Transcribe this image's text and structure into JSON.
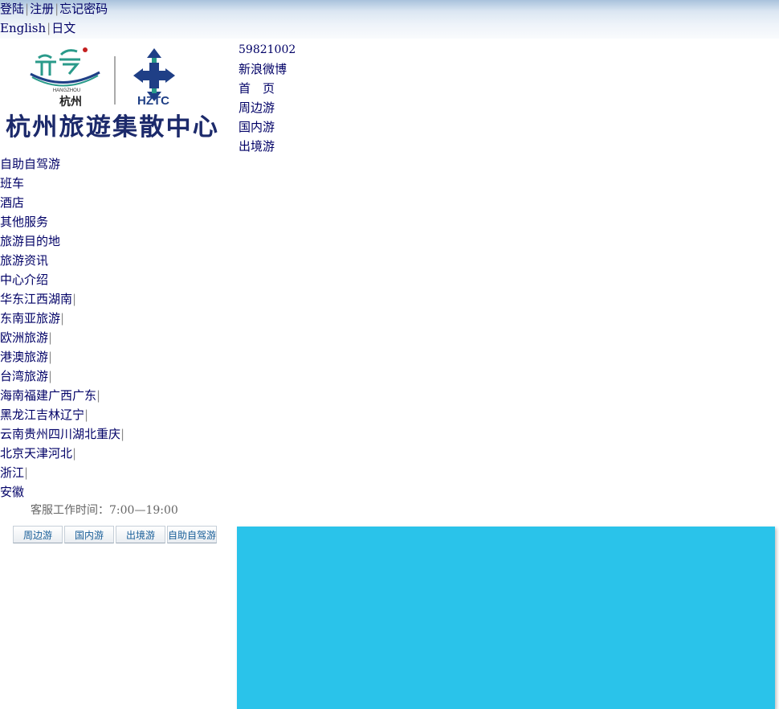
{
  "header": {
    "auth": {
      "login": "登陆",
      "register": "注册",
      "forgot": "忘记密码",
      "sep": "|"
    },
    "lang": {
      "english": "English",
      "japanese": "日文",
      "sep": "|"
    }
  },
  "logo": {
    "city_cn": "杭州",
    "city_en": "HANGZHOU",
    "brand": "HZTC",
    "name": "杭州旅遊集散中心",
    "colors": {
      "teal": "#2a9a8a",
      "navy": "#1f3f86",
      "red": "#c42020",
      "calligraphy": "#1c2a6b"
    }
  },
  "top_links": {
    "phone": "59821002",
    "weibo": "新浪微博",
    "home": "首　页",
    "items": [
      "周边游",
      "国内游",
      "出境游"
    ]
  },
  "main_nav": [
    "自助自驾游",
    "班车",
    "酒店",
    "其他服务",
    "旅游目的地",
    "旅游资讯",
    "中心介绍"
  ],
  "destinations": [
    "华东江西湖南",
    "东南亚旅游",
    "欧洲旅游",
    "港澳旅游",
    "台湾旅游",
    "海南福建广西广东",
    "黑龙江吉林辽宁",
    "云南贵州四川湖北重庆",
    "北京天津河北",
    "浙江",
    "安徽"
  ],
  "pipe": "|",
  "service_hours": "客服工作时间：7:00—19:00",
  "tabs": [
    "周边游",
    "国内游",
    "出境游",
    "自助自驾游"
  ],
  "banner_color": "#2ac3ea"
}
